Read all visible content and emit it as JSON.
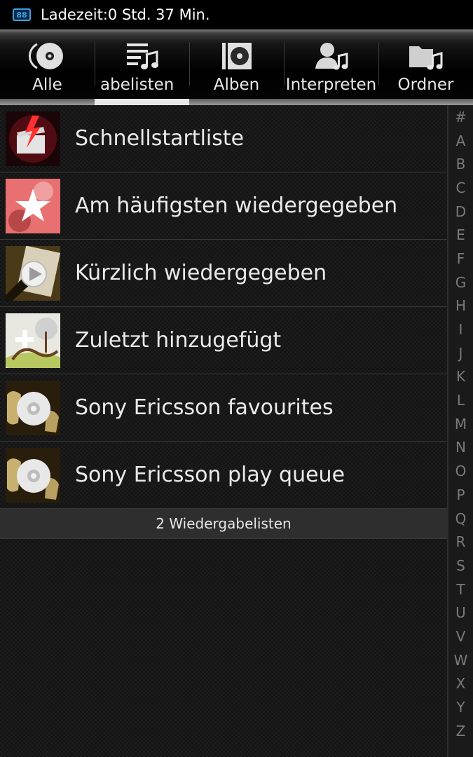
{
  "status": {
    "battery_icon_text": "88",
    "text": "Ladezeit:0 Std. 37 Min."
  },
  "tabs": [
    {
      "label": "Alle",
      "icon": "cd-icon"
    },
    {
      "label": "abelisten",
      "icon": "playlist-icon",
      "active": true
    },
    {
      "label": "Alben",
      "icon": "album-icon"
    },
    {
      "label": "Interpreten",
      "icon": "artist-icon"
    },
    {
      "label": "Ordner",
      "icon": "folder-music-icon"
    }
  ],
  "playlists": [
    {
      "label": "Schnellstartliste",
      "icon": "quickstart-thumbnail"
    },
    {
      "label": "Am häufigsten wiedergegeben",
      "icon": "star-thumbnail"
    },
    {
      "label": "Kürzlich wiedergegeben",
      "icon": "recent-play-thumbnail"
    },
    {
      "label": "Zuletzt hinzugefügt",
      "icon": "added-tree-thumbnail"
    },
    {
      "label": "Sony Ericsson favourites",
      "icon": "disc-thumbnail"
    },
    {
      "label": "Sony Ericsson play queue",
      "icon": "disc-thumbnail"
    }
  ],
  "footer": {
    "count_text": "2 Wiedergabelisten"
  },
  "alphabet": [
    "#",
    "A",
    "B",
    "C",
    "D",
    "E",
    "F",
    "G",
    "H",
    "I",
    "J",
    "K",
    "L",
    "M",
    "N",
    "O",
    "P",
    "Q",
    "R",
    "S",
    "T",
    "U",
    "V",
    "W",
    "X",
    "Y",
    "Z"
  ],
  "colors": {
    "accent": "#3aa0e8",
    "indicator": "#e8e8e8",
    "background": "#141414"
  }
}
